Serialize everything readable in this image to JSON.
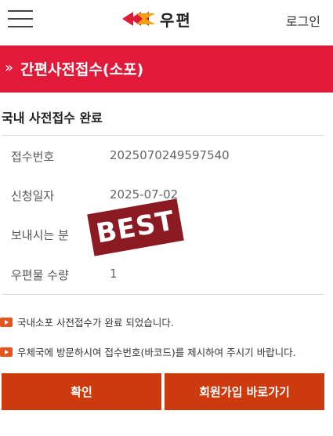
{
  "header": {
    "logo_text": "우편",
    "login_label": "로그인"
  },
  "banner": {
    "arrow": "»",
    "title": "간편사전접수(소포)"
  },
  "section": {
    "title": "국내 사전접수 완료"
  },
  "details": [
    {
      "label": "접수번호",
      "value": "2025070249597540"
    },
    {
      "label": "신청일자",
      "value": "2025-07-02"
    },
    {
      "label": "보내시는 분",
      "value": ""
    },
    {
      "label": "우편물 수량",
      "value": "1"
    }
  ],
  "stamp": {
    "text": "BEST"
  },
  "notices": [
    "국내소포 사전접수가 완료 되었습니다.",
    "우체국에 방문하시여 접수번호(바코드)를 제시하여 주시기 바랍니다."
  ],
  "buttons": {
    "confirm": "확인",
    "signup": "회원가입 바로가기"
  },
  "colors": {
    "banner": "#e11a3a",
    "button": "#cc3a0e",
    "stamp": "#8b1a22",
    "notice_icon": "#e8521b"
  }
}
